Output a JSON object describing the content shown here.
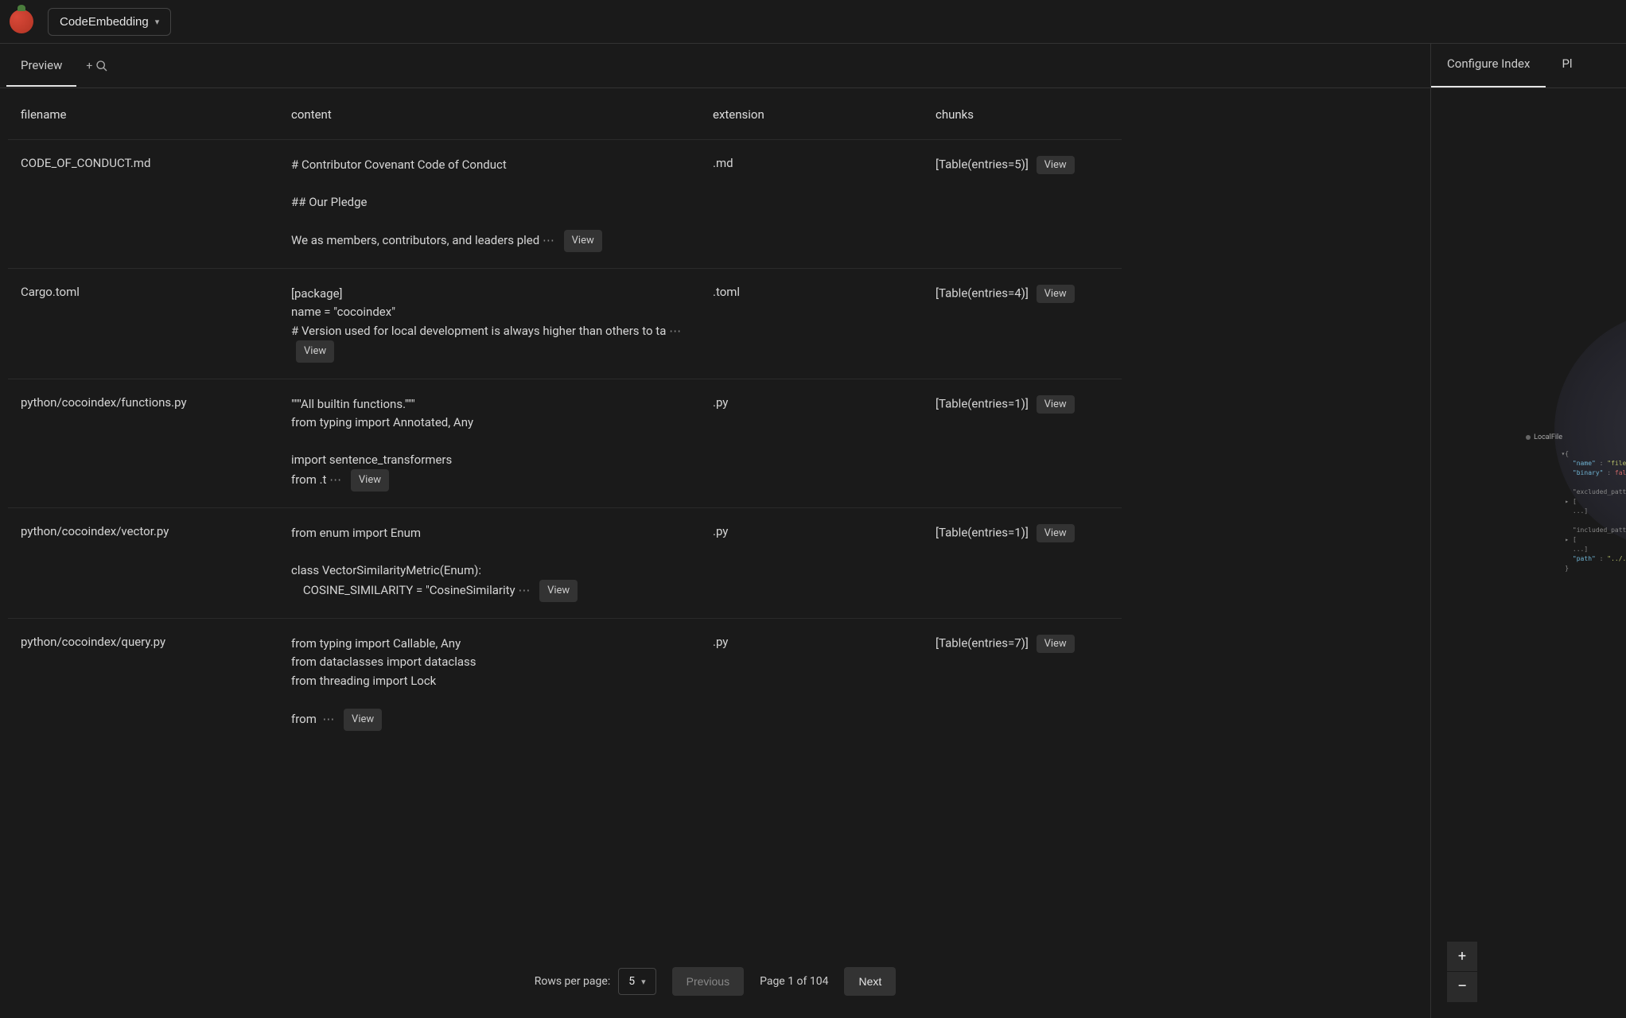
{
  "header": {
    "selector_label": "CodeEmbedding"
  },
  "left_tabs": {
    "preview": "Preview"
  },
  "columns": {
    "filename": "filename",
    "content": "content",
    "extension": "extension",
    "chunks": "chunks"
  },
  "rows": [
    {
      "filename": "CODE_OF_CONDUCT.md",
      "content": "# Contributor Covenant Code of Conduct\n\n## Our Pledge\n\nWe as members, contributors, and leaders pled ",
      "extension": ".md",
      "chunks": "[Table(entries=5)]"
    },
    {
      "filename": "Cargo.toml",
      "content": "[package]\nname = \"cocoindex\"\n# Version used for local development is always higher than others to ta ",
      "extension": ".toml",
      "chunks": "[Table(entries=4)]"
    },
    {
      "filename": "python/cocoindex/functions.py",
      "content": "\"\"\"All builtin functions.\"\"\"\nfrom typing import Annotated, Any\n\nimport sentence_transformers\nfrom .t ",
      "extension": ".py",
      "chunks": "[Table(entries=1)]"
    },
    {
      "filename": "python/cocoindex/vector.py",
      "content": "from enum import Enum\n\nclass VectorSimilarityMetric(Enum):\n    COSINE_SIMILARITY = \"CosineSimilarity ",
      "extension": ".py",
      "chunks": "[Table(entries=1)]"
    },
    {
      "filename": "python/cocoindex/query.py",
      "content": "from typing import Callable, Any\nfrom dataclasses import dataclass\nfrom threading import Lock\n\nfrom  ",
      "extension": ".py",
      "chunks": "[Table(entries=7)]"
    }
  ],
  "view_label": "View",
  "pagination": {
    "rows_label": "Rows per page:",
    "rows_value": "5",
    "previous": "Previous",
    "next": "Next",
    "page_info": "Page 1 of 104"
  },
  "right_tabs": {
    "configure": "Configure Index",
    "partial": "Pl"
  },
  "graph": {
    "node_label": "LocalFile",
    "json_text": "▾{\n   \"name\" : \"files\"\n   \"binary\" : false\n\n   \"excluded_patter\n ▸ [\n   ...]\n\n   \"included_patter\n ▸ [\n   ...]\n   \"path\" : \"../..\"\n }"
  }
}
